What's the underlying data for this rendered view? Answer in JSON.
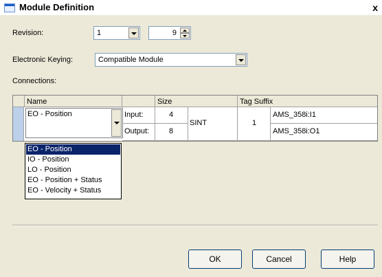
{
  "window": {
    "title": "Module Definition",
    "close_glyph": "x"
  },
  "revision": {
    "label": "Revision:",
    "major": "1",
    "minor": "9"
  },
  "keying": {
    "label": "Electronic Keying:",
    "value": "Compatible Module"
  },
  "connections": {
    "label": "Connections:"
  },
  "table": {
    "headers": {
      "name": "Name",
      "size": "Size",
      "tag_suffix": "Tag Suffix"
    },
    "row": {
      "name": "EO - Position",
      "input_label": "Input:",
      "input_size": "4",
      "output_label": "Output:",
      "output_size": "8",
      "type": "SINT",
      "slot": "1",
      "input_tag": "AMS_358i:I1",
      "output_tag": "AMS_358i:O1"
    }
  },
  "dropdown": {
    "options": [
      "EO - Position",
      "IO - Position",
      "LO - Position",
      "EO - Position  + Status",
      "EO - Velocity  + Status"
    ],
    "selected_index": 0
  },
  "buttons": {
    "ok": "OK",
    "cancel": "Cancel",
    "help": "Help"
  }
}
